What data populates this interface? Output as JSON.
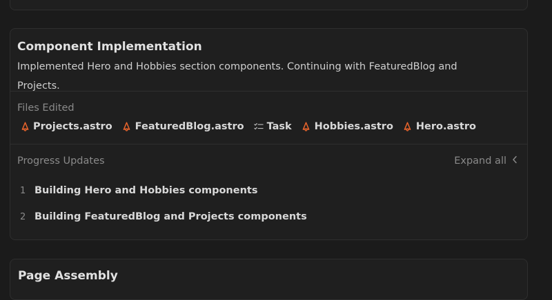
{
  "section": {
    "title": "Component Implementation",
    "description": "Implemented Hero and Hobbies section components. Continuing with FeaturedBlog and Projects."
  },
  "files": {
    "label": "Files Edited",
    "items": [
      {
        "name": "Projects.astro",
        "icon": "astro-icon"
      },
      {
        "name": "FeaturedBlog.astro",
        "icon": "astro-icon"
      },
      {
        "name": "Task",
        "icon": "checklist-icon"
      },
      {
        "name": "Hobbies.astro",
        "icon": "astro-icon"
      },
      {
        "name": "Hero.astro",
        "icon": "astro-icon"
      }
    ]
  },
  "progress": {
    "label": "Progress Updates",
    "expand_label": "Expand all",
    "steps": [
      {
        "num": "1",
        "text": "Building Hero and Hobbies components"
      },
      {
        "num": "2",
        "text": "Building FeaturedBlog and Projects components"
      }
    ]
  },
  "next_section": {
    "title": "Page Assembly"
  },
  "colors": {
    "background": "#1b1b1b",
    "card": "#1f1f1f",
    "border": "#2f2f2f",
    "astro_orange": "#e8642c",
    "muted_text": "#8a8a8a"
  }
}
